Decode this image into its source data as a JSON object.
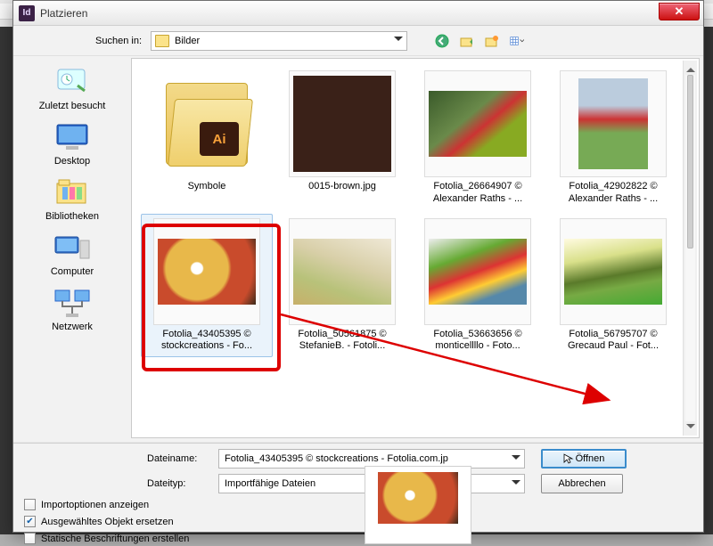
{
  "app_icon_text": "Id",
  "dialog_title": "Platzieren",
  "toolbar": {
    "search_label": "Suchen in:",
    "location": "Bilder"
  },
  "places": [
    {
      "k": "recent",
      "label": "Zuletzt besucht"
    },
    {
      "k": "desktop",
      "label": "Desktop"
    },
    {
      "k": "libraries",
      "label": "Bibliotheken"
    },
    {
      "k": "computer",
      "label": "Computer"
    },
    {
      "k": "network",
      "label": "Netzwerk"
    }
  ],
  "items": [
    {
      "label1": "Symbole",
      "label2": ""
    },
    {
      "label1": "0015-brown.jpg",
      "label2": ""
    },
    {
      "label1": "Fotolia_26664907 ©",
      "label2": "Alexander Raths - ..."
    },
    {
      "label1": "Fotolia_42902822 ©",
      "label2": "Alexander Raths - ..."
    },
    {
      "label1": "Fotolia_43405395 ©",
      "label2": "stockcreations - Fo..."
    },
    {
      "label1": "Fotolia_50561875 ©",
      "label2": "StefanieB. - Fotoli..."
    },
    {
      "label1": "Fotolia_53663656 ©",
      "label2": "monticellllo - Foto..."
    },
    {
      "label1": "Fotolia_56795707 ©",
      "label2": "Grecaud Paul - Fot..."
    }
  ],
  "fields": {
    "filename_label": "Dateiname:",
    "filename_value": "Fotolia_43405395 © stockcreations - Fotolia.com.jp",
    "filetype_label": "Dateityp:",
    "filetype_value": "Importfähige Dateien"
  },
  "buttons": {
    "open": "Öffnen",
    "cancel": "Abbrechen"
  },
  "checks": {
    "import_opts": "Importoptionen anzeigen",
    "replace_obj": "Ausgewähltes Objekt ersetzen",
    "static_caps": "Statische Beschriftungen erstellen"
  },
  "check_states": {
    "import_opts": false,
    "replace_obj": true,
    "static_caps": false
  },
  "colors": {
    "red_highlight": "#d00",
    "selection_bg": "#eaf3fb",
    "selection_border": "#9cc3e8",
    "primary_btn_border": "#3a8ccc"
  }
}
